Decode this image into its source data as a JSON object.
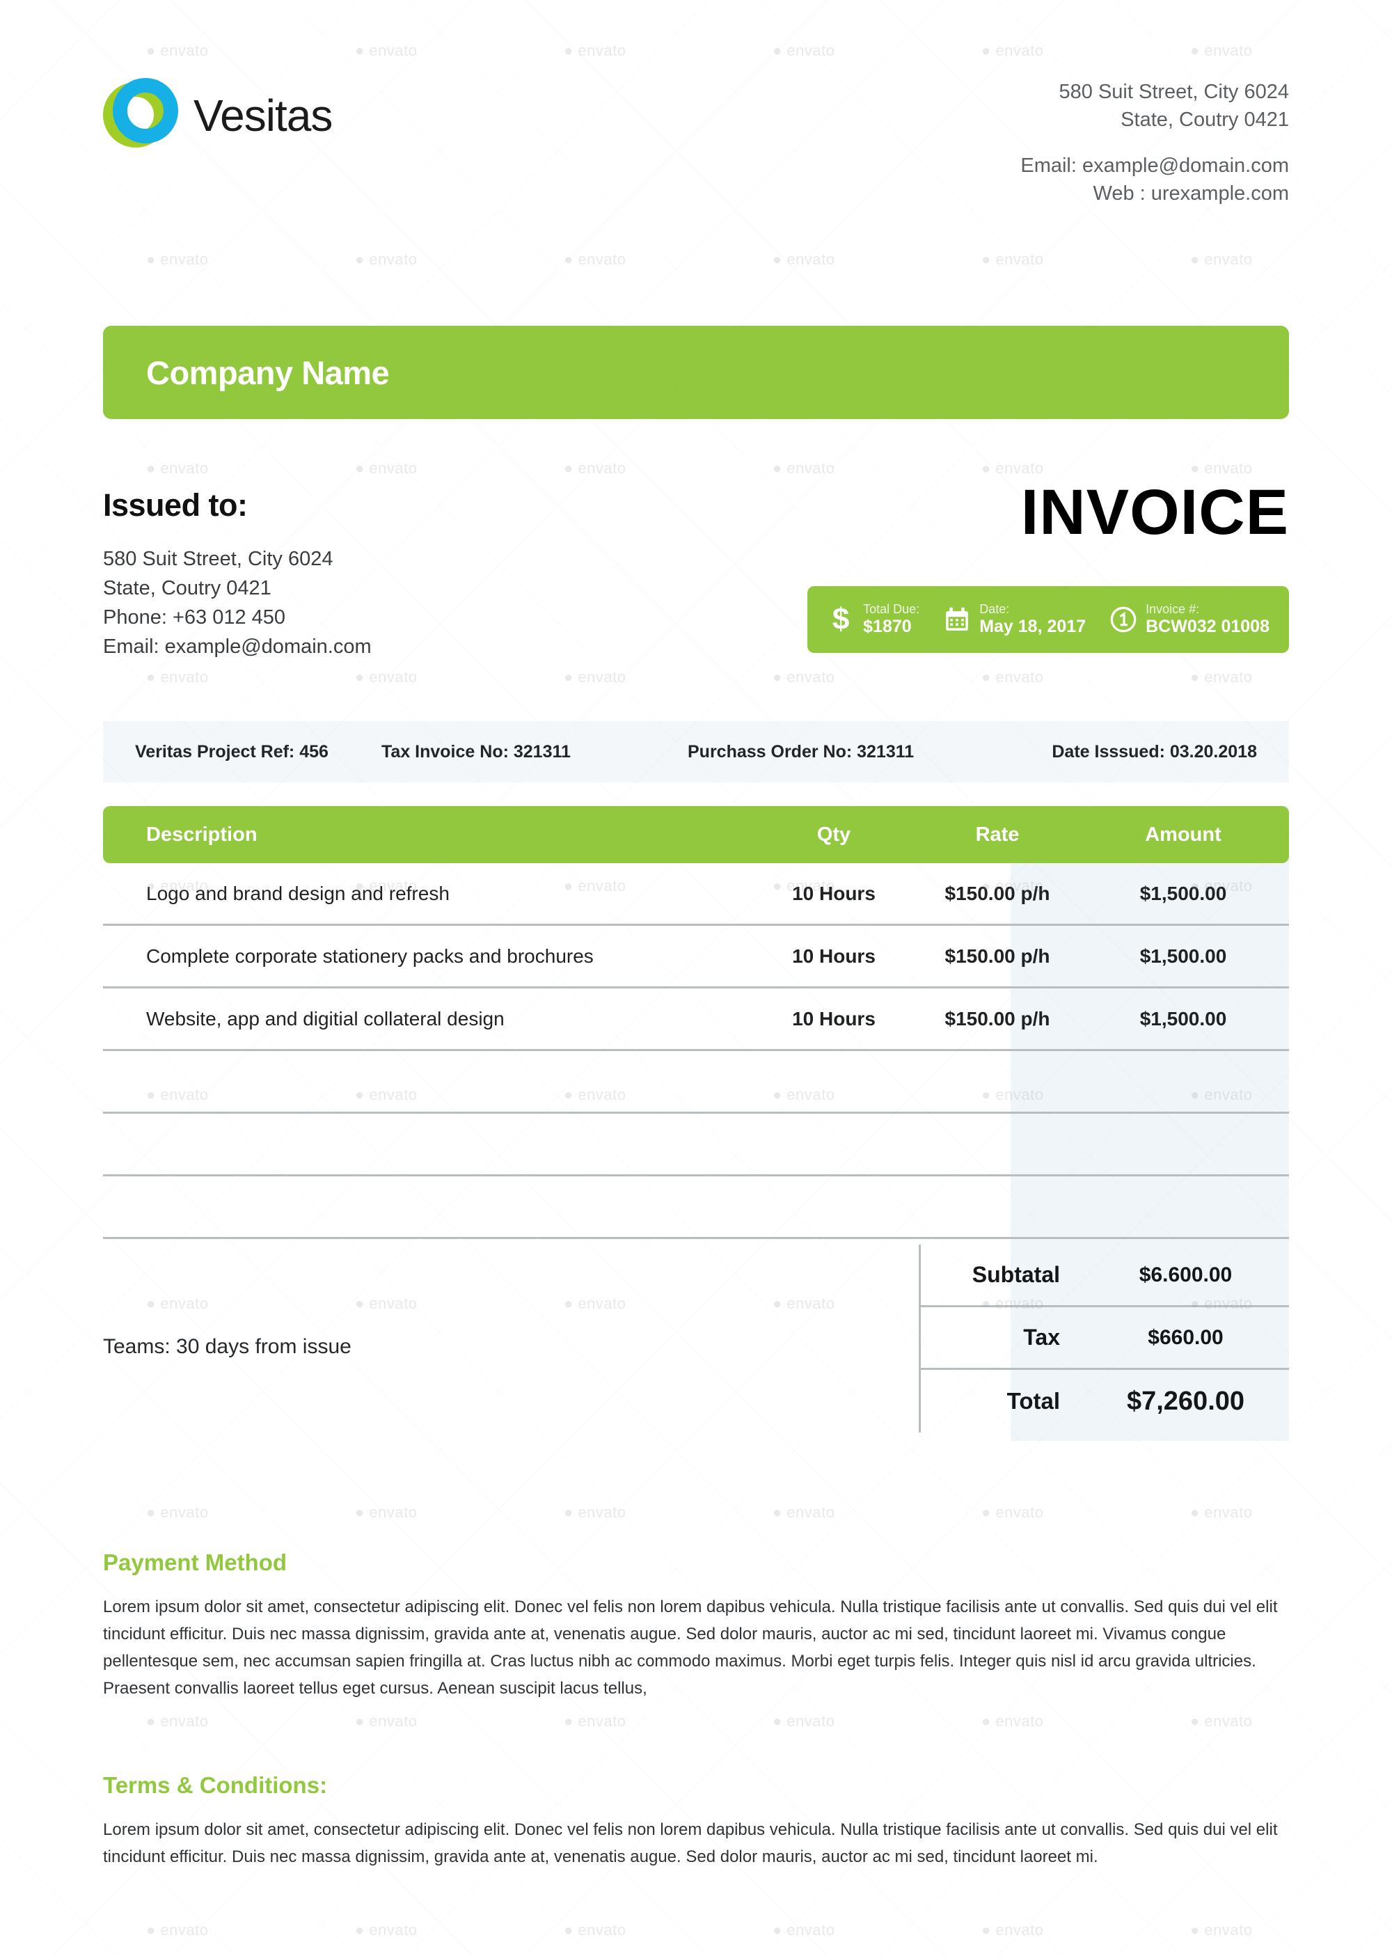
{
  "header": {
    "brand_name": "Vesitas",
    "logo_icon": "double-ring-logo-icon",
    "address_line1": "580 Suit Street, City 6024",
    "address_line2": "State, Coutry 0421",
    "email_line": "Email: example@domain.com",
    "web_line": "Web : urexample.com"
  },
  "company_bar": {
    "label": "Company Name"
  },
  "issued_to": {
    "title": "Issued to:",
    "line1": "580 Suit Street, City 6024",
    "line2": "State, Coutry 0421",
    "line3": "Phone: +63 012 450",
    "line4": "Email: example@domain.com"
  },
  "invoice": {
    "title": "INVOICE",
    "meta": [
      {
        "icon": "dollar-sign-icon",
        "key": "Total Due:",
        "value": "$1870"
      },
      {
        "icon": "calendar-icon",
        "key": "Date:",
        "value": "May 18, 2017"
      },
      {
        "icon": "circled-one-icon",
        "key": "Invoice #:",
        "value": "BCW032 01008"
      }
    ]
  },
  "reference_strip": {
    "project_ref": "Veritas Project Ref: 456",
    "tax_invoice_no": "Tax Invoice No: 321311",
    "purchase_order_no": "Purchass Order No: 321311",
    "date_issued": "Date Isssued: 03.20.2018"
  },
  "items_table": {
    "columns": [
      "Description",
      "Qty",
      "Rate",
      "Amount"
    ],
    "rows": [
      {
        "description": "Logo and brand design and refresh",
        "qty": "10 Hours",
        "rate": "$150.00 p/h",
        "amount": "$1,500.00"
      },
      {
        "description": "Complete corporate stationery packs and brochures",
        "qty": "10 Hours",
        "rate": "$150.00 p/h",
        "amount": "$1,500.00"
      },
      {
        "description": "Website, app and digitial collateral design",
        "qty": "10 Hours",
        "rate": "$150.00 p/h",
        "amount": "$1,500.00"
      },
      {
        "description": "",
        "qty": "",
        "rate": "",
        "amount": ""
      },
      {
        "description": "",
        "qty": "",
        "rate": "",
        "amount": ""
      },
      {
        "description": "",
        "qty": "",
        "rate": "",
        "amount": ""
      }
    ]
  },
  "terms_note": "Teams: 30 days from issue",
  "totals": {
    "subtotal_label": "Subtatal",
    "subtotal_value": "$6.600.00",
    "tax_label": "Tax",
    "tax_value": "$660.00",
    "total_label": "Total",
    "total_value": "$7,260.00"
  },
  "payment_method": {
    "title": "Payment Method",
    "body": "Lorem ipsum dolor sit amet, consectetur adipiscing elit. Donec vel felis non lorem dapibus vehicula. Nulla tristique facilisis ante ut convallis. Sed quis dui vel elit tincidunt efficitur. Duis nec massa dignissim, gravida ante at, venenatis augue. Sed dolor mauris, auctor ac mi sed, tincidunt laoreet mi. Vivamus congue pellentesque sem, nec accumsan sapien fringilla at. Cras luctus nibh ac commodo maximus. Morbi eget turpis felis. Integer quis nisl id arcu gravida ultricies. Praesent convallis laoreet tellus eget cursus. Aenean suscipit lacus tellus,"
  },
  "terms_conditions": {
    "title": "Terms & Conditions:",
    "body": "Lorem ipsum dolor sit amet, consectetur adipiscing elit. Donec vel felis non lorem dapibus vehicula. Nulla tristique facilisis ante ut convallis. Sed quis dui vel elit tincidunt efficitur. Duis nec massa dignissim, gravida ante at, venenatis augue. Sed dolor mauris, auctor ac mi sed, tincidunt laoreet mi."
  },
  "colors": {
    "brand_green": "#92c83d",
    "logo_green": "#a0ce26",
    "logo_blue": "#16b0e6",
    "strip_bg": "#f3f7fa",
    "amount_column_bg": "#eff5f9",
    "rule": "#b8bdc0"
  },
  "watermark": {
    "text": "envato"
  }
}
